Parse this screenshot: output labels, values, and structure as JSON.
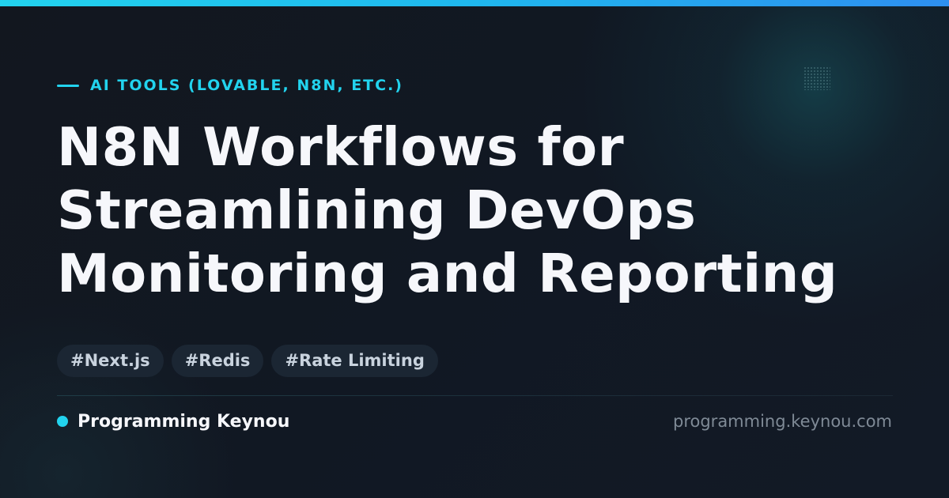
{
  "theme": {
    "accent_color": "#22d3ee",
    "background_color": "#111824",
    "title_color": "#f6f7fb",
    "muted_color": "#7f8a96",
    "tag_background": "#1b2633"
  },
  "category": {
    "label": "AI TOOLS (LOVABLE, N8N, ETC.)"
  },
  "title": {
    "lines": [
      "N8N Workflows for",
      "Streamlining DevOps",
      "Monitoring and Reporting"
    ]
  },
  "tags": [
    "#Next.js",
    "#Redis",
    "#Rate Limiting"
  ],
  "footer": {
    "brand_name": "Programming Keynou",
    "site_url": "programming.keynou.com"
  }
}
